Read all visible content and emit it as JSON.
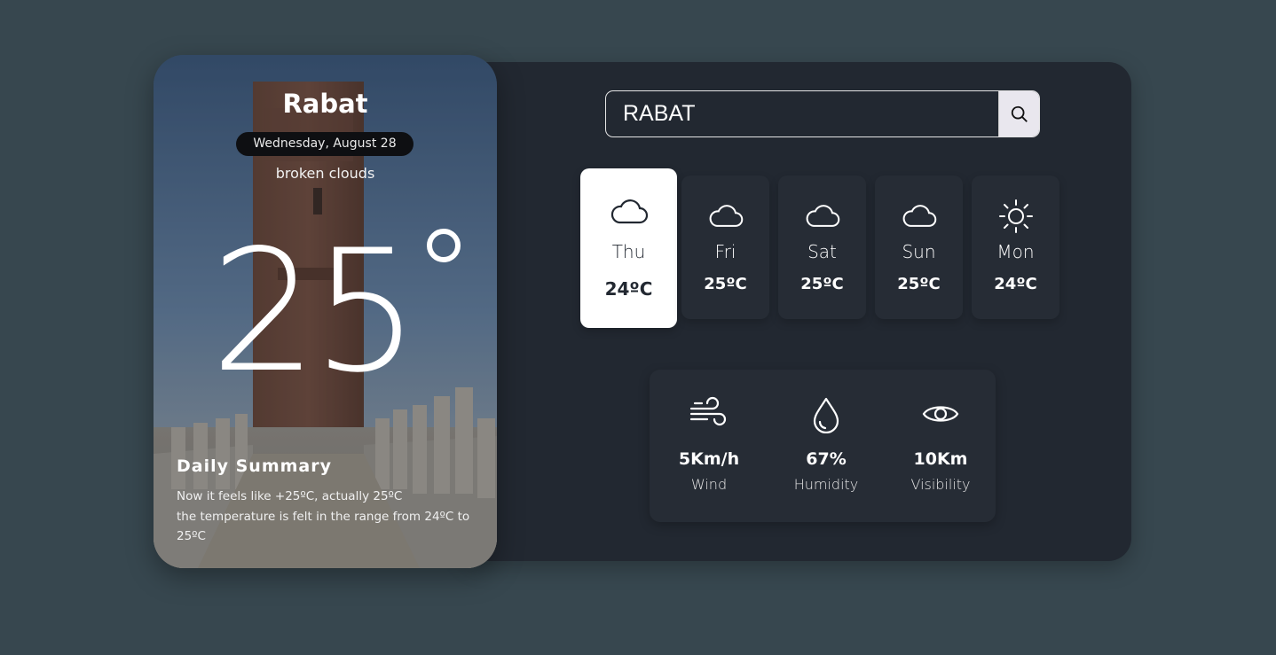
{
  "current": {
    "city": "Rabat",
    "date": "Wednesday, August 28",
    "description": "broken clouds",
    "temperature": "25",
    "summary_title": "Daily Summary",
    "summary_line1": "Now it feels like +25ºC, actually 25ºC",
    "summary_line2": "the temperature is felt in the range from 24ºC to 25ºC"
  },
  "search": {
    "value": "RABAT",
    "icon": "search-icon"
  },
  "forecast": [
    {
      "day": "Thu",
      "temp": "24ºC",
      "icon": "cloud-icon",
      "selected": true
    },
    {
      "day": "Fri",
      "temp": "25ºC",
      "icon": "cloud-icon",
      "selected": false
    },
    {
      "day": "Sat",
      "temp": "25ºC",
      "icon": "cloud-icon",
      "selected": false
    },
    {
      "day": "Sun",
      "temp": "25ºC",
      "icon": "cloud-icon",
      "selected": false
    },
    {
      "day": "Mon",
      "temp": "24ºC",
      "icon": "sun-icon",
      "selected": false
    }
  ],
  "stats": [
    {
      "value": "5Km/h",
      "label": "Wind",
      "icon": "wind-icon"
    },
    {
      "value": "67%",
      "label": "Humidity",
      "icon": "droplet-icon"
    },
    {
      "value": "10Km",
      "label": "Visibility",
      "icon": "eye-icon"
    }
  ],
  "colors": {
    "page_bg": "#37474f",
    "panel_bg": "#222831",
    "active_card": "#ffffff"
  }
}
